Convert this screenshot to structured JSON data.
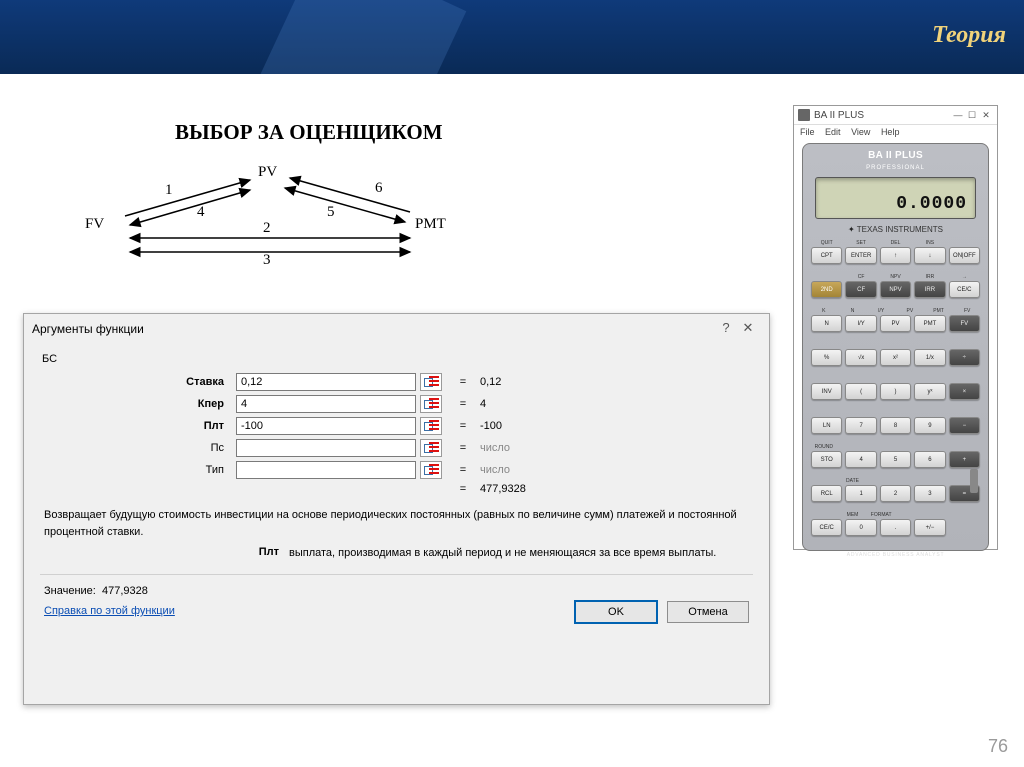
{
  "header": {
    "title": "Теория"
  },
  "main_title": "ВЫБОР ЗА ОЦЕНЩИКОМ",
  "diagram": {
    "nodes": {
      "fv": "FV",
      "pv": "PV",
      "pmt": "PMT"
    },
    "edges": {
      "e1": "1",
      "e2": "2",
      "e3": "3",
      "e4": "4",
      "e5": "5",
      "e6": "6"
    }
  },
  "dialog": {
    "title": "Аргументы функции",
    "fn": "БС",
    "rows": [
      {
        "label": "Ставка",
        "bold": true,
        "value": "0,12",
        "res": "0,12"
      },
      {
        "label": "Кпер",
        "bold": true,
        "value": "4",
        "res": "4"
      },
      {
        "label": "Плт",
        "bold": true,
        "value": "-100",
        "res": "-100"
      },
      {
        "label": "Пс",
        "bold": false,
        "value": "",
        "res": "число",
        "grey": true
      },
      {
        "label": "Тип",
        "bold": false,
        "value": "",
        "res": "число",
        "grey": true
      }
    ],
    "total_eq": "=",
    "total": "477,9328",
    "desc": "Возвращает будущую стоимость инвестиции на основе периодических постоянных (равных по величине сумм) платежей и постоянной процентной ставки.",
    "param_name": "Плт",
    "param_desc": "выплата, производимая в каждый период и не меняющаяся за все время выплаты.",
    "value_label": "Значение:",
    "value": "477,9328",
    "help": "Справка по этой функции",
    "ok": "OK",
    "cancel": "Отмена"
  },
  "calc": {
    "win_title": "BA II PLUS",
    "menu": [
      "File",
      "Edit",
      "View",
      "Help"
    ],
    "brand": "BA II PLUS",
    "brand2": "PROFESSIONAL",
    "display": "0.0000",
    "ti": "TEXAS INSTRUMENTS",
    "labels": [
      [
        "QUIT",
        "SET",
        "DEL",
        "INS",
        ""
      ],
      [
        "",
        "CF",
        "NPV",
        "IRR",
        "→"
      ],
      [
        "K",
        "N",
        "I/Y",
        "PV",
        "PMT",
        "FV"
      ],
      [
        "",
        "",
        "",
        "",
        "",
        ""
      ],
      [
        "",
        "",
        "",
        "",
        "",
        ""
      ],
      [
        "",
        "",
        "",
        "",
        "",
        ""
      ],
      [
        "ROUND",
        "",
        "",
        "",
        "",
        ""
      ],
      [
        "",
        "DATE",
        "",
        "",
        "",
        ""
      ],
      [
        "",
        "MEM",
        "FORMAT",
        "",
        "",
        ""
      ]
    ],
    "keys_top": [
      [
        "CPT",
        "ENTER",
        "↑",
        "↓",
        "ON|OFF"
      ],
      [
        "2ND",
        "CF",
        "NPV",
        "IRR",
        "CE/C"
      ]
    ],
    "keys_grid": [
      [
        "N",
        "I/Y",
        "PV",
        "PMT",
        "FV"
      ],
      [
        "%",
        "√x",
        "x²",
        "1/x",
        "÷"
      ],
      [
        "INV",
        "(",
        ")",
        "yˣ",
        "×"
      ],
      [
        "LN",
        "7",
        "8",
        "9",
        "−"
      ],
      [
        "STO",
        "4",
        "5",
        "6",
        "+"
      ],
      [
        "RCL",
        "1",
        "2",
        "3",
        "="
      ],
      [
        "CE/C",
        "0",
        ".",
        "+/−",
        ""
      ]
    ],
    "adv": "ADVANCED BUSINESS ANALYST"
  },
  "page_number": "76"
}
